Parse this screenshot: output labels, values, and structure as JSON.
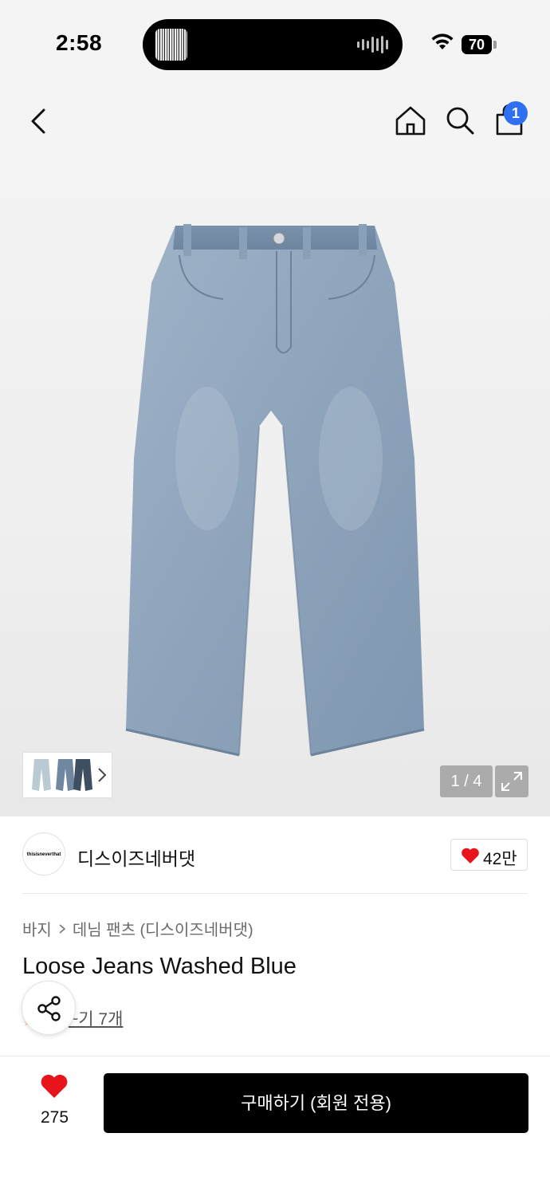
{
  "status_bar": {
    "time": "2:58",
    "battery": "70"
  },
  "header": {
    "cart_count": "1"
  },
  "gallery": {
    "counter": "1 / 4"
  },
  "brand": {
    "name": "디스이즈네버댓",
    "logo_text": "thisisneverthat",
    "like_count": "42만"
  },
  "product": {
    "breadcrumb": [
      "바지",
      "데님 팬츠 (디스이즈네버댓)"
    ],
    "title": "Loose Jeans Washed Blue",
    "review_text": "~기 7개"
  },
  "bottom_bar": {
    "wish_count": "275",
    "buy_label": "구매하기 (회원 전용)"
  },
  "colors": {
    "accent_badge": "#2f6ff2",
    "heart": "#e8141c",
    "buy_button": "#000000"
  }
}
